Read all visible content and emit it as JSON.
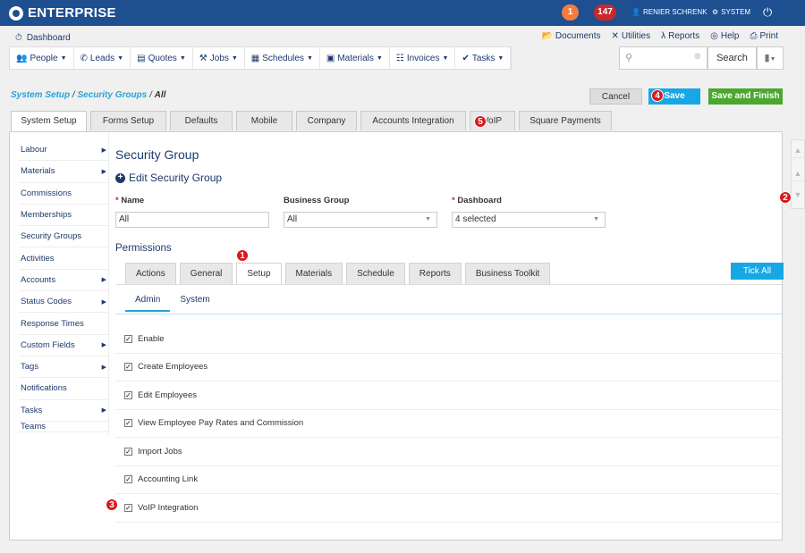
{
  "topbar": {
    "brand": "ENTERPRISE",
    "notifications_count": "1",
    "alerts_count": "147",
    "user_name": "RENIER SCHRENK",
    "system_label": "SYSTEM"
  },
  "header": {
    "dashboard_label": "Dashboard",
    "links": [
      "Documents",
      "Utilities",
      "Reports",
      "Help",
      "Print"
    ],
    "nav": [
      {
        "label": "People"
      },
      {
        "label": "Leads"
      },
      {
        "label": "Quotes"
      },
      {
        "label": "Jobs"
      },
      {
        "label": "Schedules"
      },
      {
        "label": "Materials"
      },
      {
        "label": "Invoices"
      },
      {
        "label": "Tasks"
      }
    ],
    "search_placeholder": "",
    "search_button": "Search"
  },
  "breadcrumb": {
    "parts": [
      "System Setup",
      "Security Groups",
      "All"
    ]
  },
  "actions": {
    "cancel": "Cancel",
    "save": "Save",
    "save_finish": "Save and Finish"
  },
  "top_tabs": [
    "System Setup",
    "Forms Setup",
    "Defaults",
    "Mobile",
    "Company",
    "Accounts Integration",
    "VoIP",
    "Square Payments"
  ],
  "sidebar": [
    {
      "label": "Labour",
      "caret": true
    },
    {
      "label": "Materials",
      "caret": true
    },
    {
      "label": "Commissions",
      "caret": false
    },
    {
      "label": "Memberships",
      "caret": false
    },
    {
      "label": "Security Groups",
      "caret": false
    },
    {
      "label": "Activities",
      "caret": false
    },
    {
      "label": "Accounts",
      "caret": true
    },
    {
      "label": "Status Codes",
      "caret": true
    },
    {
      "label": "Response Times",
      "caret": false
    },
    {
      "label": "Custom Fields",
      "caret": true
    },
    {
      "label": "Tags",
      "caret": true
    },
    {
      "label": "Notifications",
      "caret": false
    },
    {
      "label": "Tasks",
      "caret": true
    },
    {
      "label": "Teams",
      "caret": false
    }
  ],
  "form": {
    "title": "Security Group",
    "subtitle": "Edit Security Group",
    "name_label": "Name",
    "name_value": "All",
    "business_group_label": "Business Group",
    "business_group_value": "All",
    "dashboard_label": "Dashboard",
    "dashboard_value": "4 selected",
    "required_mark": "*"
  },
  "permissions": {
    "title": "Permissions",
    "tabs": [
      "Actions",
      "General",
      "Setup",
      "Materials",
      "Schedule",
      "Reports",
      "Business Toolkit"
    ],
    "tick_all": "Tick All",
    "subtabs": [
      "Admin",
      "System"
    ],
    "items": [
      {
        "label": "Enable",
        "checked": true
      },
      {
        "label": "Create Employees",
        "checked": true
      },
      {
        "label": "Edit Employees",
        "checked": true
      },
      {
        "label": "View Employee Pay Rates and Commission",
        "checked": true
      },
      {
        "label": "Import Jobs",
        "checked": true
      },
      {
        "label": "Accounting Link",
        "checked": true
      },
      {
        "label": "VoIP Integration",
        "checked": true
      }
    ]
  },
  "callouts": [
    "1",
    "2",
    "3",
    "4",
    "5"
  ]
}
